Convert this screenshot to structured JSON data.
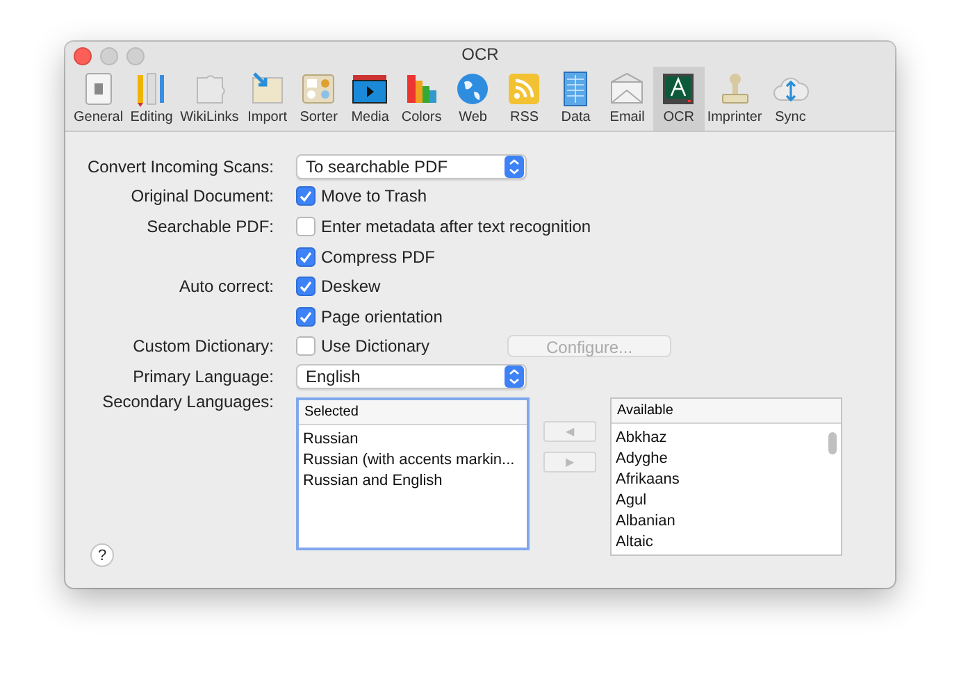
{
  "window": {
    "title": "OCR"
  },
  "toolbar": [
    {
      "label": "General",
      "kind": "switch",
      "selected": false
    },
    {
      "label": "Editing",
      "kind": "pencils",
      "selected": false
    },
    {
      "label": "WikiLinks",
      "kind": "puzzle",
      "selected": false
    },
    {
      "label": "Import",
      "kind": "import",
      "selected": false
    },
    {
      "label": "Sorter",
      "kind": "sorter",
      "selected": false
    },
    {
      "label": "Media",
      "kind": "media",
      "selected": false
    },
    {
      "label": "Colors",
      "kind": "colors",
      "selected": false
    },
    {
      "label": "Web",
      "kind": "globe",
      "selected": false
    },
    {
      "label": "RSS",
      "kind": "rss",
      "selected": false
    },
    {
      "label": "Data",
      "kind": "data",
      "selected": false
    },
    {
      "label": "Email",
      "kind": "email",
      "selected": false
    },
    {
      "label": "OCR",
      "kind": "ocr",
      "selected": true
    },
    {
      "label": "Imprinter",
      "kind": "stamp",
      "selected": false
    },
    {
      "label": "Sync",
      "kind": "cloud",
      "selected": false
    }
  ],
  "form": [
    {
      "label": "Convert Incoming Scans:",
      "kind": "select",
      "value": "To searchable PDF"
    },
    {
      "label": "Original Document:",
      "kind": "checkbox",
      "text": "Move to Trash",
      "checked": true
    },
    {
      "label": "Searchable PDF:",
      "kind": "checkbox",
      "text": "Enter metadata after text recognition",
      "checked": false
    },
    {
      "kind": "checkbox",
      "text": "Compress PDF",
      "checked": true
    },
    {
      "label": "Auto correct:",
      "kind": "checkbox",
      "text": "Deskew",
      "checked": true
    },
    {
      "kind": "checkbox",
      "text": "Page orientation",
      "checked": true
    },
    {
      "label": "Custom Dictionary:",
      "kind": "checkbox",
      "text": "Use Dictionary",
      "checked": false,
      "button": {
        "label": "Configure...",
        "disabled": true
      }
    },
    {
      "label": "Primary Language:",
      "kind": "select",
      "value": "English"
    }
  ],
  "secondary_languages": {
    "label": "Secondary Languages:",
    "selected_list": {
      "header": "Selected",
      "focused": true,
      "items": [
        "Russian",
        "Russian (with accents markin...",
        "Russian and English"
      ]
    },
    "move_buttons": [
      "◀",
      "▶"
    ],
    "available_list": {
      "header": "Available",
      "items": [
        "Abkhaz",
        "Adyghe",
        "Afrikaans",
        "Agul",
        "Albanian",
        "Altaic"
      ]
    }
  },
  "help_button": "?"
}
